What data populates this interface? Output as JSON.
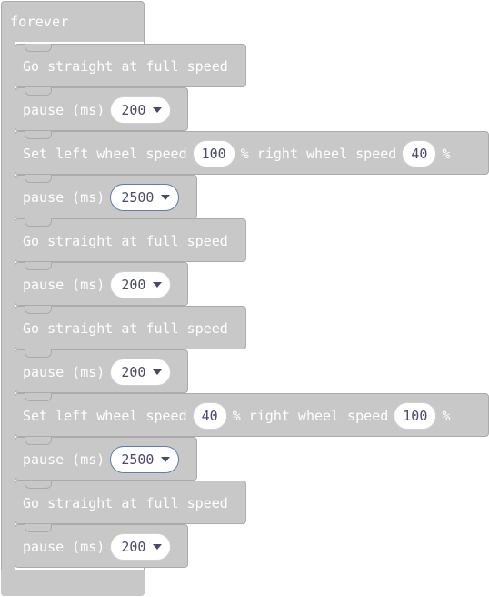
{
  "forever": {
    "label": "forever"
  },
  "blocks": [
    {
      "type": "straight",
      "label": "Go straight at full speed"
    },
    {
      "type": "pause",
      "label": "pause (ms)",
      "value": "200"
    },
    {
      "type": "wheels",
      "left_label": "Set left wheel speed",
      "left_value": "100",
      "mid_label": "% right wheel speed",
      "right_value": "40",
      "end_label": "%"
    },
    {
      "type": "pause",
      "label": "pause (ms)",
      "value": "2500"
    },
    {
      "type": "straight",
      "label": "Go straight at full speed"
    },
    {
      "type": "pause",
      "label": "pause (ms)",
      "value": "200"
    },
    {
      "type": "straight",
      "label": "Go straight at full speed"
    },
    {
      "type": "pause",
      "label": "pause (ms)",
      "value": "200"
    },
    {
      "type": "wheels",
      "left_label": "Set left wheel speed",
      "left_value": "40",
      "mid_label": "% right wheel speed",
      "right_value": "100",
      "end_label": "%"
    },
    {
      "type": "pause",
      "label": "pause (ms)",
      "value": "2500"
    },
    {
      "type": "straight",
      "label": "Go straight at full speed"
    },
    {
      "type": "pause",
      "label": "pause (ms)",
      "value": "200"
    }
  ]
}
